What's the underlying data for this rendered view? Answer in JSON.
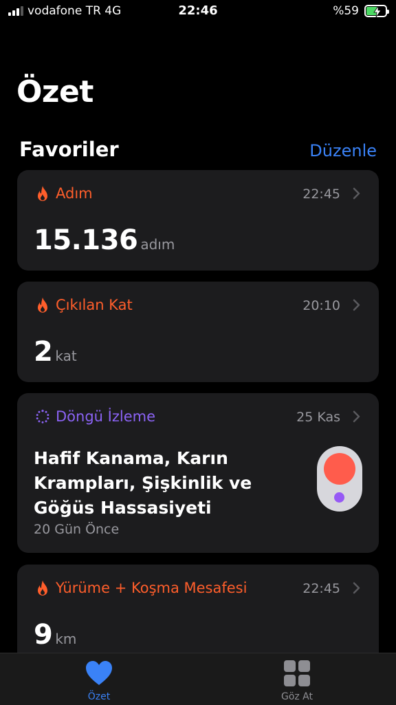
{
  "status_bar": {
    "carrier": "vodafone TR  4G",
    "time": "22:46",
    "battery_percent": "%59",
    "battery_level": 0.59,
    "signal_bars": 3
  },
  "page_title": "Özet",
  "favorites": {
    "title": "Favoriler",
    "edit_label": "Düzenle"
  },
  "cards": {
    "steps": {
      "title": "Adım",
      "time": "22:45",
      "value": "15.136",
      "unit": "adım",
      "icon": "flame-icon"
    },
    "floors": {
      "title": "Çıkılan Kat",
      "time": "20:10",
      "value": "2",
      "unit": "kat",
      "icon": "flame-icon"
    },
    "cycle": {
      "title": "Döngü İzleme",
      "date": "25 Kas",
      "symptoms": "Hafif Kanama, Karın Krampları, Şişkinlik ve Göğüs Hassasiyeti",
      "ago": "20 Gün Önce",
      "icon": "cycle-tracking-icon"
    },
    "distance": {
      "title": "Yürüme + Koşma Mesafesi",
      "time": "22:45",
      "value": "9",
      "unit": "km",
      "icon": "flame-icon"
    }
  },
  "tab_bar": {
    "summary_label": "Özet",
    "browse_label": "Göz At"
  },
  "colors": {
    "accent_blue": "#3a82f7",
    "activity_orange": "#ff5e2b",
    "cycle_purple": "#8b63f5",
    "card_bg": "#1c1c1e"
  }
}
